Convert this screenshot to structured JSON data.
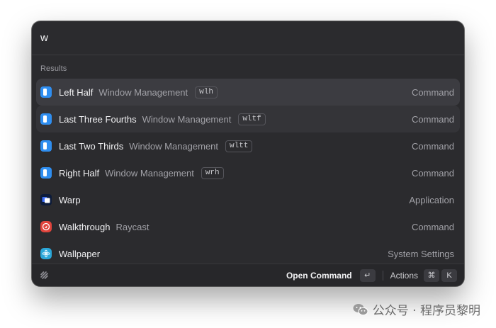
{
  "search": {
    "value": "w"
  },
  "results": {
    "section_title": "Results",
    "items": [
      {
        "title": "Left Half",
        "subtitle": "Window Management",
        "alias": "wlh",
        "type": "Command",
        "icon": "window-management-icon"
      },
      {
        "title": "Last Three Fourths",
        "subtitle": "Window Management",
        "alias": "wltf",
        "type": "Command",
        "icon": "window-management-icon"
      },
      {
        "title": "Last Two Thirds",
        "subtitle": "Window Management",
        "alias": "wltt",
        "type": "Command",
        "icon": "window-management-icon"
      },
      {
        "title": "Right Half",
        "subtitle": "Window Management",
        "alias": "wrh",
        "type": "Command",
        "icon": "window-management-icon"
      },
      {
        "title": "Warp",
        "subtitle": "",
        "alias": "",
        "type": "Application",
        "icon": "warp-app-icon"
      },
      {
        "title": "Walkthrough",
        "subtitle": "Raycast",
        "alias": "",
        "type": "Command",
        "icon": "raycast-walkthrough-icon"
      },
      {
        "title": "Wallpaper",
        "subtitle": "",
        "alias": "",
        "type": "System Settings",
        "icon": "wallpaper-icon"
      }
    ]
  },
  "footer": {
    "primary_action": "Open Command",
    "enter_key": "↵",
    "actions_label": "Actions",
    "cmd_key": "⌘",
    "k_key": "K"
  },
  "watermark": {
    "text": "公众号 · 程序员黎明"
  },
  "colors": {
    "window_bg": "#2b2b2e",
    "selected_row": "#3c3c41",
    "accent_blue": "#2f8ef0"
  }
}
